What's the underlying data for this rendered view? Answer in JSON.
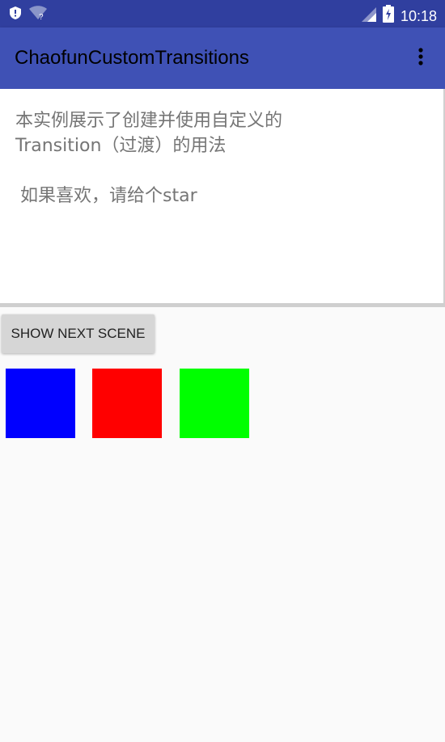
{
  "status_bar": {
    "time": "10:18",
    "icons": [
      "shield-icon",
      "wifi-unknown-icon",
      "cell-signal-icon",
      "battery-charging-icon"
    ]
  },
  "app_bar": {
    "title": "ChaofunCustomTransitions",
    "menu_icon": "more-vert-icon"
  },
  "intro": {
    "line1": "本实例展示了创建并使用自定义的",
    "line2": "Transition（过渡）的用法",
    "line3": "如果喜欢，请给个star"
  },
  "actions": {
    "next_scene_label": "SHOW NEXT SCENE"
  },
  "scene": {
    "squares": [
      {
        "name": "blue",
        "color": "#0000ff"
      },
      {
        "name": "red",
        "color": "#ff0000"
      },
      {
        "name": "green",
        "color": "#00ff00"
      }
    ]
  },
  "colors": {
    "status_bar": "#303f9f",
    "app_bar": "#3f51b5",
    "background": "#fafafa"
  }
}
